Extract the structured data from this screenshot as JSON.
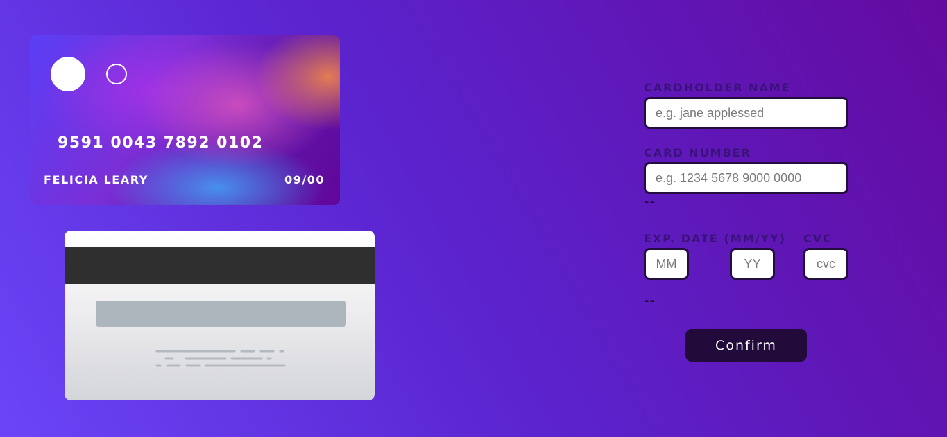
{
  "card_front": {
    "number": "9591 0043 7892 0102",
    "holder_name": "FELICIA LEARY",
    "expiry": "09/00"
  },
  "form": {
    "cardholder_label": "CARDHOLDER NAME",
    "cardholder_placeholder": "e.g. jane applessed",
    "number_label": "CARD NUMBER",
    "number_placeholder": "e.g. 1234 5678 9000 0000",
    "number_error": "--",
    "exp_label": "EXP. DATE (MM/YY)",
    "month_placeholder": "MM",
    "year_placeholder": "YY",
    "cvc_label": "CVC",
    "cvc_placeholder": "cvc",
    "exp_error": "--",
    "confirm_label": "Confirm"
  }
}
